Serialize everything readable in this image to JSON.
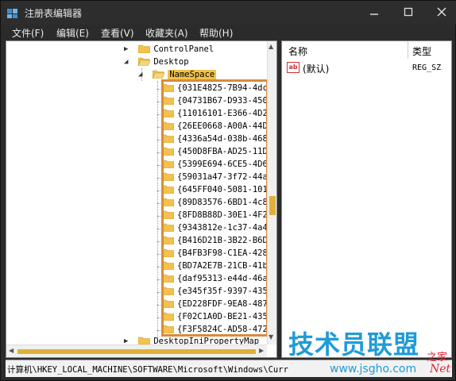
{
  "window": {
    "title": "注册表编辑器"
  },
  "menu": {
    "items": [
      "文件(F)",
      "编辑(E)",
      "查看(V)",
      "收藏夹(A)",
      "帮助(H)"
    ]
  },
  "tree": {
    "control_panel": "ControlPanel",
    "desktop": "Desktop",
    "namespace": "NameSpace",
    "children": [
      "{031E4825-7B94-4dc",
      "{04731B67-D933-450",
      "{11016101-E366-4D2",
      "{26EE0668-A00A-44D",
      "{4336a54d-038b-468",
      "{450D8FBA-AD25-11D",
      "{5399E694-6CE5-4D6",
      "{59031a47-3f72-44a",
      "{645FF040-5081-101",
      "{89D83576-6BD1-4c8",
      "{8FD8B88D-30E1-4F2",
      "{9343812e-1c37-4a4",
      "{B416D21B-3B22-B6D",
      "{B4FB3F98-C1EA-428",
      "{BD7A2E7B-21CB-41b",
      "{daf95313-e44d-46a",
      "{e345f35f-9397-435",
      "{ED228FDF-9EA8-487",
      "{F02C1A0D-BE21-435",
      "{F3F5824C-AD58-472"
    ],
    "partial_next": "DesktopIniPropertyMap"
  },
  "values_list": {
    "col_name": "名称",
    "col_type": "类型",
    "rows": [
      {
        "name": "(默认)",
        "type": "REG_SZ",
        "icon": "ab"
      }
    ]
  },
  "status": {
    "path": "计算机\\HKEY_LOCAL_MACHINE\\SOFTWARE\\Microsoft\\Windows\\Curr"
  },
  "watermark": {
    "main": "技术员联盟",
    "sub": "之家",
    "url": "www.jsgho.com",
    "net": "Net"
  },
  "colors": {
    "selection": "#f3c24a",
    "highlight_box": "#d98b3a",
    "folder": "#f2c14e",
    "watermark_blue": "#1f9bd7"
  }
}
